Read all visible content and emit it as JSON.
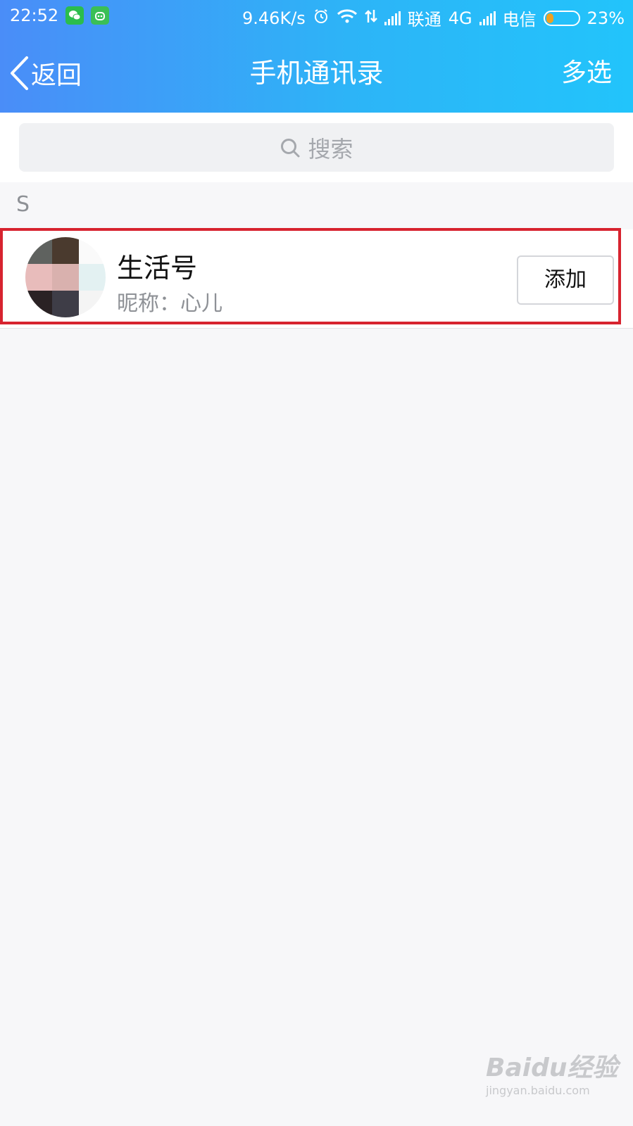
{
  "status_bar": {
    "time": "22:52",
    "net_speed": "9.46K/s",
    "carrier1": "联通",
    "network1": "4G",
    "carrier2": "电信",
    "battery_text": "23%",
    "battery_level": 0.23,
    "icons": [
      "wechat-icon",
      "bot-icon",
      "alarm-icon",
      "wifi-icon",
      "data-arrows-icon",
      "signal-icon",
      "signal-icon",
      "battery-icon"
    ]
  },
  "nav": {
    "back_label": "返回",
    "title": "手机通讯录",
    "multi_select_label": "多选"
  },
  "search": {
    "placeholder": "搜索"
  },
  "section": {
    "letter": "S"
  },
  "contact": {
    "name": "生活号",
    "nickname": "昵称：心儿",
    "add_label": "添加"
  },
  "colors": {
    "header_start": "#4a8df8",
    "header_end": "#22c4fb",
    "highlight_border": "#d7232f",
    "background": "#f7f7f9"
  },
  "watermark": {
    "logo": "Baidu经验",
    "url": "jingyan.baidu.com"
  }
}
